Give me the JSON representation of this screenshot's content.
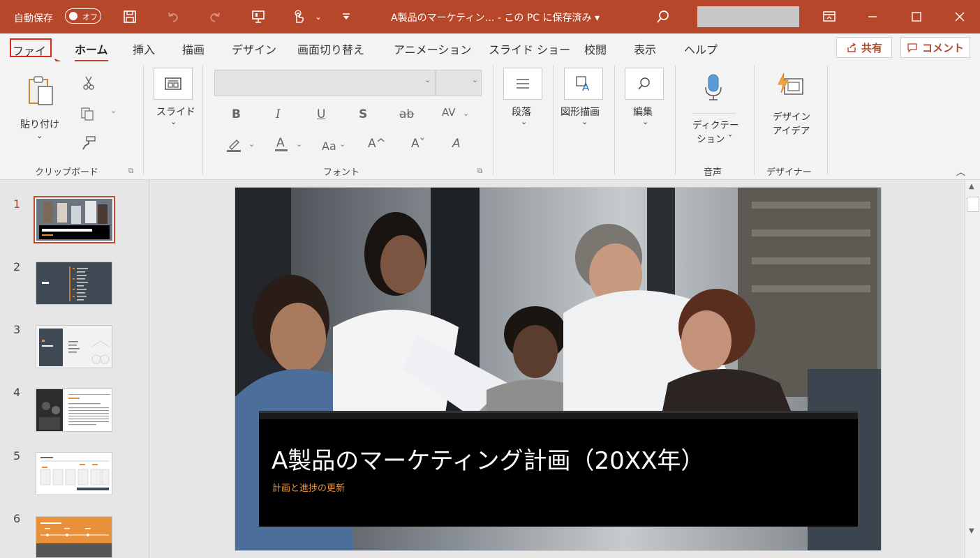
{
  "titlebar": {
    "autosave_label": "自動保存",
    "autosave_state": "オフ",
    "doc_title": "A製品のマーケティン…  - この PC に保存済み ▾",
    "icons": [
      "save-icon",
      "undo-icon",
      "redo-icon",
      "present-icon",
      "touch-mode-icon",
      "customize-icon",
      "search-icon",
      "ribbon-display-icon",
      "minimize-icon",
      "maximize-icon",
      "close-icon"
    ]
  },
  "tabs": {
    "file": "ファイル",
    "home": "ホーム",
    "insert": "挿入",
    "draw": "描画",
    "design": "デザイン",
    "transitions": "画面切り替え",
    "animations": "アニメーション",
    "slideshow": "スライド ショー",
    "review": "校閲",
    "view": "表示",
    "help": "ヘルプ",
    "share": "共有",
    "comment": "コメント"
  },
  "ribbon": {
    "clipboard": {
      "paste": "貼り付け",
      "label": "クリップボード"
    },
    "slides": {
      "slide": "スライド"
    },
    "font": {
      "label": "フォント",
      "bold": "B",
      "italic": "I",
      "underline": "U",
      "shadow": "S",
      "strike": "ab",
      "spacing": "AV",
      "highlight": "ab",
      "color": "A",
      "case": "Aa",
      "grow": "A^",
      "shrink": "Aˇ",
      "clear": "A"
    },
    "paragraph": {
      "label": "段落"
    },
    "drawing": {
      "label": "図形描画"
    },
    "editing": {
      "label": "編集"
    },
    "voice": {
      "dictate_line1": "ディクテー",
      "dictate_line2": "ション ˇ",
      "label": "音声"
    },
    "designer": {
      "line1": "デザイン",
      "line2": "アイデア",
      "label": "デザイナー"
    }
  },
  "thumbnails": [
    {
      "number": "1",
      "title": "A製品のマーケティング計画（20XX年）"
    },
    {
      "number": "2"
    },
    {
      "number": "3"
    },
    {
      "number": "4"
    },
    {
      "number": "5"
    },
    {
      "number": "6"
    }
  ],
  "slide": {
    "title": "A製品のマーケティング計画（20XX年）",
    "subtitle": "計画と進捗の更新"
  },
  "colors": {
    "accent": "#b7472a",
    "highlight_box": "#e0261d",
    "subtitle": "#e8913a"
  }
}
